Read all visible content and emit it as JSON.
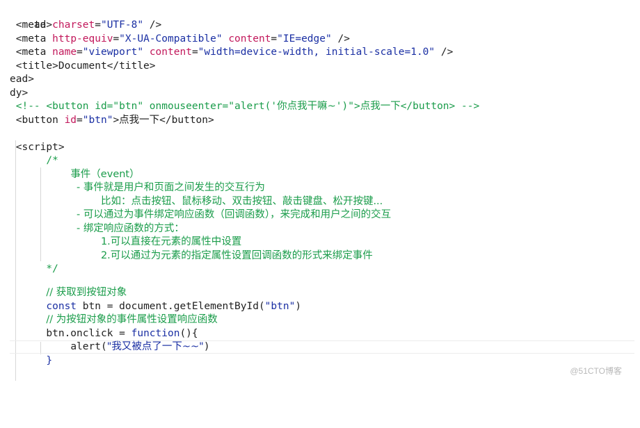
{
  "lines": [
    {
      "text": "ad>"
    },
    {
      "meta_charset": "<meta charset=\"UTF-8\" />"
    },
    {
      "meta_http": "<meta http-equiv=\"X-UA-Compatible\" content=\"IE=edge\" />"
    },
    {
      "meta_viewport": "<meta name=\"viewport\" content=\"width=device-width, initial-scale=1.0\" />"
    },
    {
      "title": "<title>Document</title>"
    },
    {
      "text": "ead>"
    },
    {
      "text": "dy>"
    }
  ],
  "code": {
    "l1": "ad>",
    "l2_tag_open": "<meta",
    "l2_attr": "charset",
    "l2_eq": "=",
    "l2_val": "\"UTF-8\"",
    "l2_close": " />",
    "l3_tag_open": "<meta",
    "l3_attr1": "http-equiv",
    "l3_val1": "\"X-UA-Compatible\"",
    "l3_attr2": "content",
    "l3_val2": "\"IE=edge\"",
    "l3_close": " />",
    "l4_tag_open": "<meta",
    "l4_attr1": "name",
    "l4_val1": "\"viewport\"",
    "l4_attr2": "content",
    "l4_val2": "\"width=device-width, initial-scale=1.0\"",
    "l4_close": " />",
    "l5_title": "<title>Document</title>",
    "l6": "ead>",
    "l7": "dy>",
    "l8_comment_a": "<!-- <button id=\"btn\" onmouseenter=\"alert('",
    "l8_comment_zh": "你点我干嘛~",
    "l8_comment_b": "')\">",
    "l8_comment_zh2": "点我一下",
    "l8_comment_c": "</button> -->",
    "l9_open": "<button",
    "l9_attr": "id",
    "l9_val": "\"btn\"",
    "l9_gt": ">",
    "l9_zh": "点我一下",
    "l9_close": "</button>",
    "l10_script": "<script>",
    "l11_comment_open": "/*",
    "l12_zh": "事件（event）",
    "l13_zh": "- 事件就是用户和页面之间发生的交互行为",
    "l14_zh": "比如：点击按钮、鼠标移动、双击按钮、敲击键盘、松开按键...",
    "l15_zh": "- 可以通过为事件绑定响应函数（回调函数），来完成和用户之间的交互",
    "l16_zh": "- 绑定响应函数的方式：",
    "l17_zh": "1.可以直接在元素的属性中设置",
    "l18_zh": "2.可以通过为元素的指定属性设置回调函数的形式来绑定事件",
    "l19_comment_close": "*/",
    "l21_comment": "// 获取到按钮对象",
    "l22_const": "const",
    "l22_rest": " btn = document.getElementById(",
    "l22_str": "\"btn\"",
    "l22_end": ")",
    "l23_comment": "// 为按钮对象的事件属性设置响应函数",
    "l24_start": "btn.onclick = ",
    "l24_fn": "function",
    "l24_end": "(){",
    "l25_alert": "alert(",
    "l25_str": "\"我又被点了一下~~\"",
    "l25_end": ")",
    "l26_brace": "}"
  },
  "watermark": "@51CTO博客",
  "colors": {
    "attribute": "#c2185b",
    "string": "#1a2fa3",
    "comment": "#1a9c4a",
    "keyword": "#1a2fa3"
  }
}
